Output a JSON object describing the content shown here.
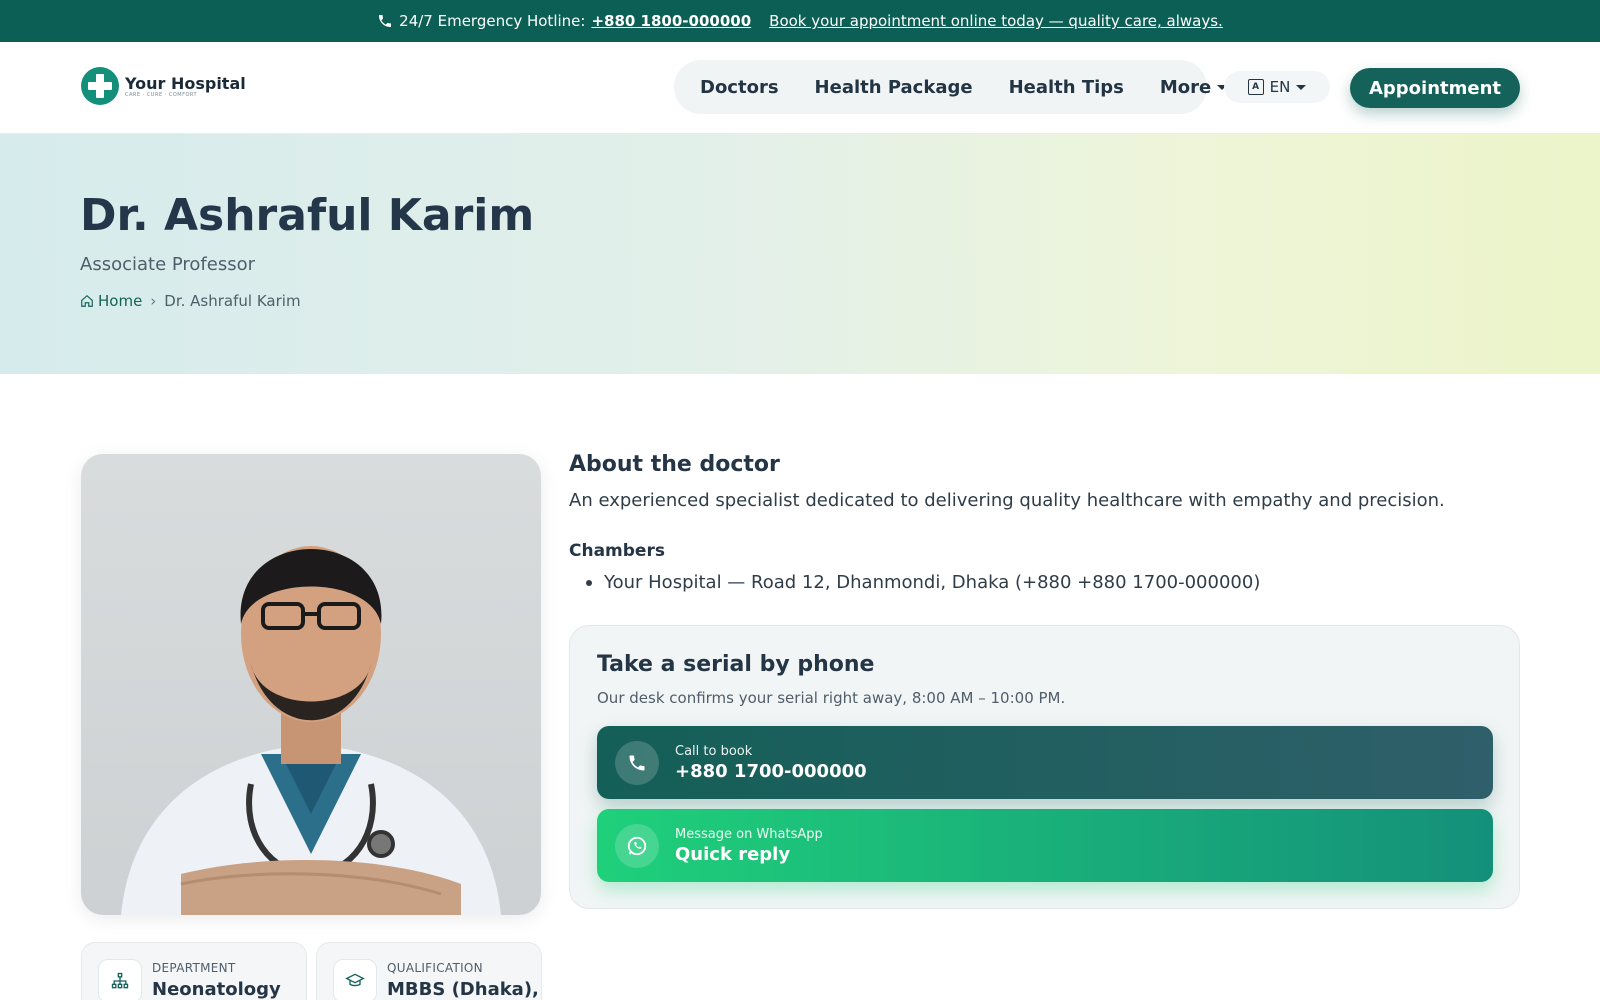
{
  "topbar": {
    "hotline_label": "24/7 Emergency Hotline:",
    "hotline_number": "+880 1800-000000",
    "promo_link": "Book your appointment online today — quality care, always."
  },
  "header": {
    "logo_name": "Your Hospital",
    "logo_tagline": "CARE · CURE · COMFORT",
    "nav": [
      "Doctors",
      "Health Package",
      "Health Tips",
      "More"
    ],
    "language": "EN",
    "appointment_button": "Appointment"
  },
  "hero": {
    "doctor_name": "Dr. Ashraful Karim",
    "designation": "Associate Professor",
    "breadcrumb_home": "Home",
    "breadcrumb_current": "Dr. Ashraful Karim"
  },
  "about": {
    "heading": "About the doctor",
    "text": "An experienced specialist dedicated to delivering quality healthcare with empathy and precision.",
    "chambers_heading": "Chambers",
    "chambers": [
      "Your Hospital — Road 12, Dhanmondi, Dhaka (+880 +880 1700-000000)"
    ]
  },
  "serial": {
    "heading": "Take a serial by phone",
    "subtext": "Our desk confirms your serial right away, 8:00 AM – 10:00 PM.",
    "call_small": "Call to book",
    "call_big": "+880 1700-000000",
    "wa_small": "Message on WhatsApp",
    "wa_big": "Quick reply"
  },
  "info_cards": {
    "department_label": "DEPARTMENT",
    "department_value": "Neonatology",
    "qualification_label": "QUALIFICATION",
    "qualification_value": "MBBS (Dhaka),"
  },
  "colors": {
    "primary": "#14625a",
    "topbar": "#0b5f54",
    "whatsapp": "#1fd07a"
  }
}
